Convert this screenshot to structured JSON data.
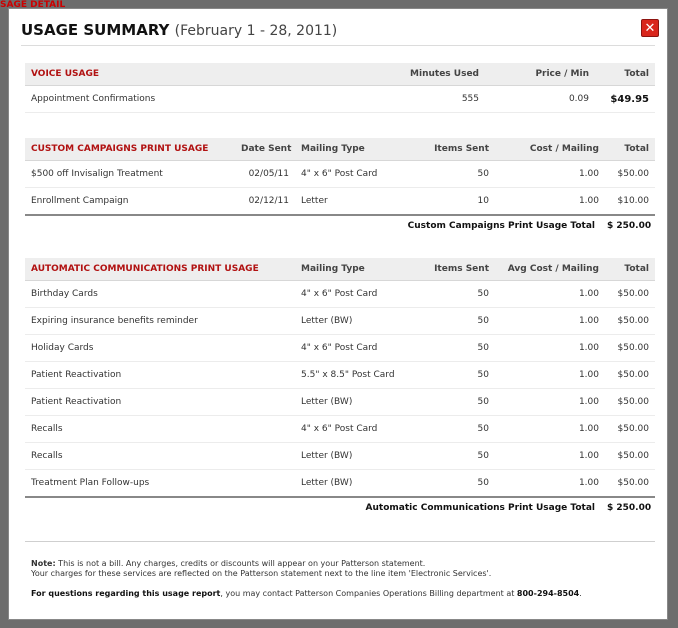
{
  "modal": {
    "title": "USAGE SUMMARY",
    "range": "(February 1 - 28, 2011)",
    "close_symbol": "✕"
  },
  "voice": {
    "headers": [
      "VOICE USAGE",
      "Minutes Used",
      "Price / Min",
      "Total"
    ],
    "rows": [
      {
        "name": "Appointment Confirmations",
        "minutes": "555",
        "price": "0.09",
        "total": "$49.95"
      }
    ]
  },
  "custom": {
    "headers": [
      "CUSTOM CAMPAIGNS PRINT USAGE",
      "Date Sent",
      "Mailing Type",
      "Items Sent",
      "Cost / Mailing",
      "Total"
    ],
    "rows": [
      {
        "name": "$500 off Invisalign Treatment",
        "date": "02/05/11",
        "type": "4\" x 6\" Post Card",
        "items": "50",
        "cost": "1.00",
        "total": "$50.00"
      },
      {
        "name": "Enrollment Campaign",
        "date": "02/12/11",
        "type": "Letter",
        "items": "10",
        "cost": "1.00",
        "total": "$10.00"
      }
    ],
    "total_label": "Custom Campaigns Print Usage Total",
    "total_value": "$ 250.00"
  },
  "auto": {
    "headers": [
      "AUTOMATIC COMMUNICATIONS PRINT USAGE",
      "Mailing Type",
      "Items Sent",
      "Avg Cost / Mailing",
      "Total"
    ],
    "rows": [
      {
        "name": "Birthday Cards",
        "type": "4\" x 6\" Post Card",
        "items": "50",
        "cost": "1.00",
        "total": "$50.00"
      },
      {
        "name": "Expiring insurance benefits reminder",
        "type": "Letter (BW)",
        "items": "50",
        "cost": "1.00",
        "total": "$50.00"
      },
      {
        "name": "Holiday Cards",
        "type": "4\" x 6\" Post Card",
        "items": "50",
        "cost": "1.00",
        "total": "$50.00"
      },
      {
        "name": "Patient Reactivation",
        "type": "5.5\" x 8.5\" Post Card",
        "items": "50",
        "cost": "1.00",
        "total": "$50.00"
      },
      {
        "name": "Patient Reactivation",
        "type": "Letter (BW)",
        "items": "50",
        "cost": "1.00",
        "total": "$50.00"
      },
      {
        "name": "Recalls",
        "type": "4\" x 6\" Post Card",
        "items": "50",
        "cost": "1.00",
        "total": "$50.00"
      },
      {
        "name": "Recalls",
        "type": "Letter (BW)",
        "items": "50",
        "cost": "1.00",
        "total": "$50.00"
      },
      {
        "name": "Treatment Plan Follow-ups",
        "type": "Letter (BW)",
        "items": "50",
        "cost": "1.00",
        "total": "$50.00"
      }
    ],
    "total_label": "Automatic Communications Print Usage Total",
    "total_value": "$ 250.00"
  },
  "footer": {
    "note_label": "Note:",
    "note_line1": " This is not a bill.  Any charges, credits or discounts will appear on your Patterson statement.",
    "note_line2": "Your charges for these services are reflected on the Patterson statement next to the line item 'Electronic Services'.",
    "contact_label": "For questions regarding this usage report",
    "contact_text": ", you may contact Patterson Companies Operations Billing department at ",
    "phone": "800-294-8504",
    "period": "."
  },
  "background": {
    "peek_text": "SAGE DETAIL"
  }
}
